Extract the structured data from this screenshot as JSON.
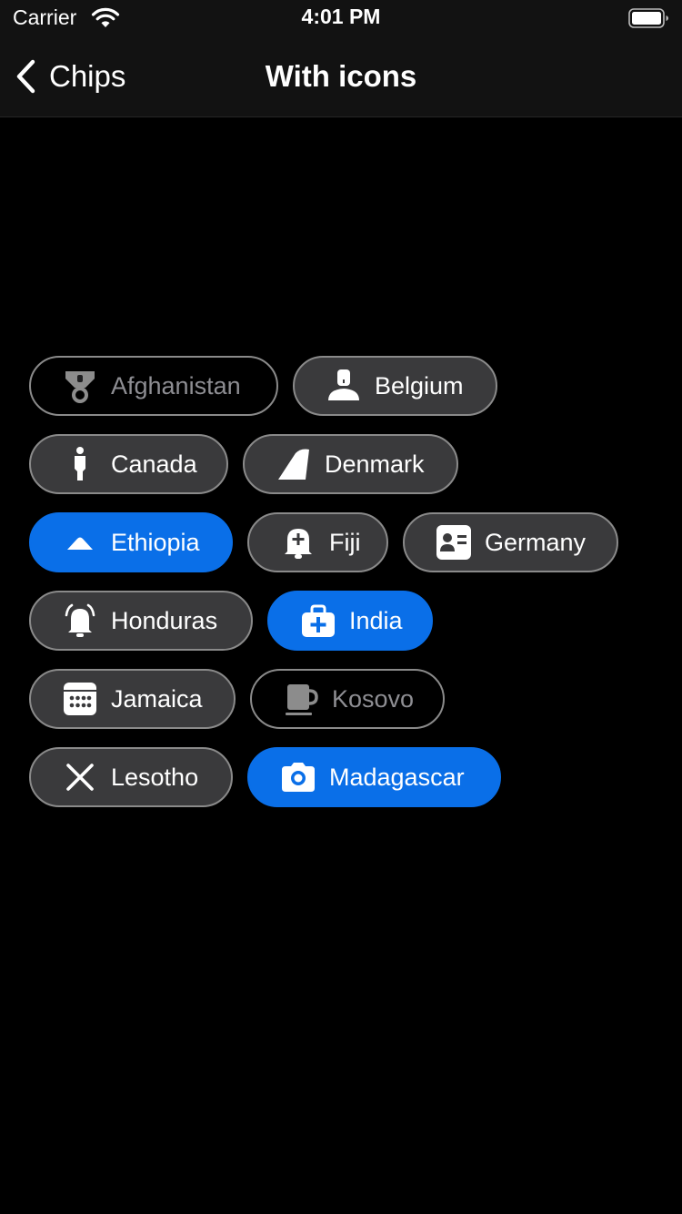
{
  "status_bar": {
    "carrier": "Carrier",
    "time": "4:01 PM"
  },
  "nav": {
    "back_label": "Chips",
    "title": "With icons"
  },
  "chips": [
    {
      "label": "Afghanistan",
      "icon": "medal-icon"
    },
    {
      "label": "Belgium",
      "icon": "person-icon"
    },
    {
      "label": "Canada",
      "icon": "standing-person-icon"
    },
    {
      "label": "Denmark",
      "icon": "tail-fin-icon"
    },
    {
      "label": "Ethiopia",
      "icon": "cloud-icon"
    },
    {
      "label": "Fiji",
      "icon": "bell-plus-icon"
    },
    {
      "label": "Germany",
      "icon": "contact-card-icon"
    },
    {
      "label": "Honduras",
      "icon": "ringing-bell-icon"
    },
    {
      "label": "India",
      "icon": "medical-bag-icon"
    },
    {
      "label": "Jamaica",
      "icon": "calendar-icon"
    },
    {
      "label": "Kosovo",
      "icon": "mug-icon"
    },
    {
      "label": "Lesotho",
      "icon": "close-icon"
    },
    {
      "label": "Madagascar",
      "icon": "camera-icon"
    }
  ],
  "colors": {
    "background": "#000000",
    "bar": "#121212",
    "chip_fill": "#3a3a3c",
    "chip_selected": "#0a6fe8",
    "chip_border": "#8a8a8a"
  }
}
